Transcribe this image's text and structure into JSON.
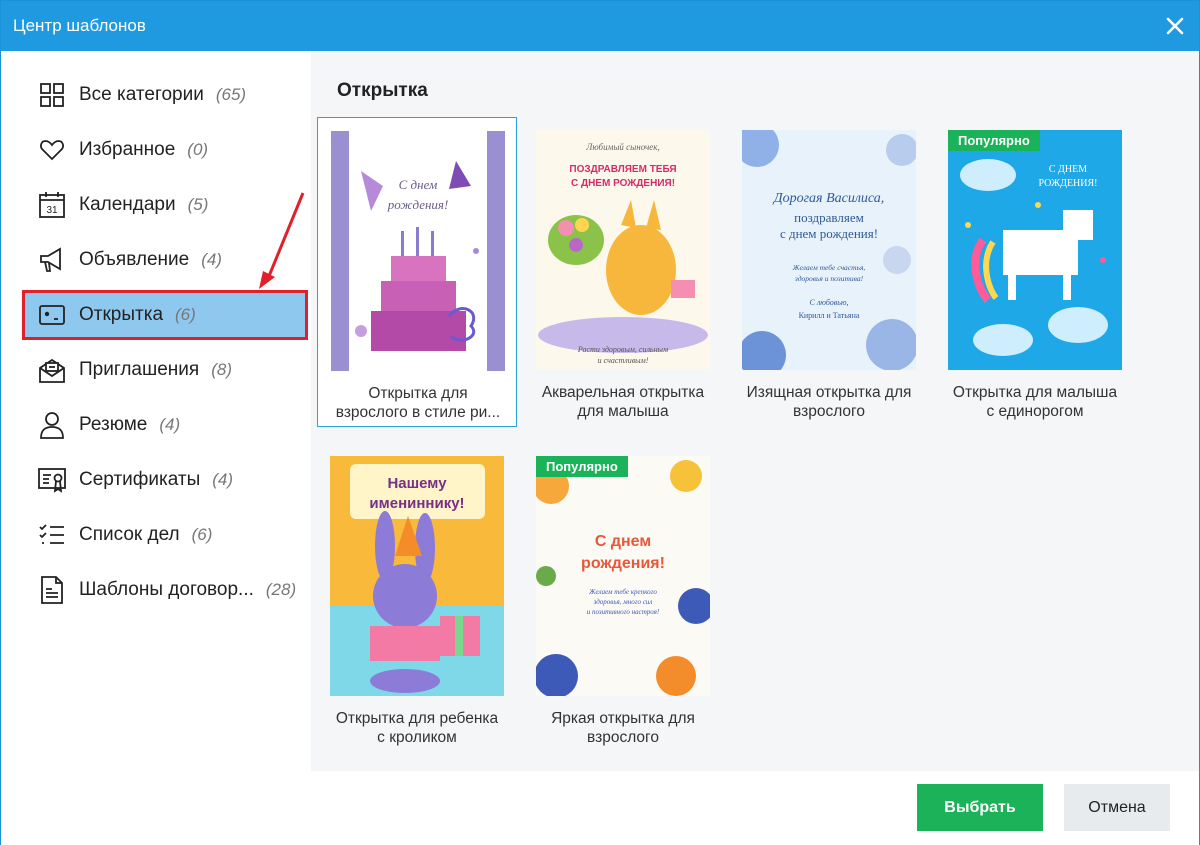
{
  "window": {
    "title": "Центр шаблонов"
  },
  "sidebar": {
    "items": [
      {
        "label": "Все категории",
        "count": "(65)",
        "icon": "grid-icon"
      },
      {
        "label": "Избранное",
        "count": "(0)",
        "icon": "heart-icon"
      },
      {
        "label": "Календари",
        "count": "(5)",
        "icon": "calendar-icon",
        "icon_text": "31"
      },
      {
        "label": "Объявление",
        "count": "(4)",
        "icon": "megaphone-icon"
      },
      {
        "label": "Открытка",
        "count": "(6)",
        "icon": "postcard-icon",
        "active": true
      },
      {
        "label": "Приглашения",
        "count": "(8)",
        "icon": "invitation-icon"
      },
      {
        "label": "Резюме",
        "count": "(4)",
        "icon": "person-icon"
      },
      {
        "label": "Сертификаты",
        "count": "(4)",
        "icon": "certificate-icon"
      },
      {
        "label": "Список дел",
        "count": "(6)",
        "icon": "checklist-icon"
      },
      {
        "label": "Шаблоны договор...",
        "count": "(28)",
        "icon": "document-icon"
      }
    ]
  },
  "main": {
    "section_title": "Открытка",
    "cards": [
      {
        "line1": "Открытка для",
        "line2": "взрослого в стиле ри...",
        "selected": true,
        "thumb": {
          "t1": "С днем",
          "t2": "рождения!"
        }
      },
      {
        "line1": "Акварельная открытка",
        "line2": "для малыша",
        "thumb": {
          "t1": "Любимый сыночек,",
          "t2": "ПОЗДРАВЛЯЕМ ТЕБЯ",
          "t3": "С ДНЕМ РОЖДЕНИЯ!",
          "t4": "Расти здоровым, сильным",
          "t5": "и счастливым!"
        }
      },
      {
        "line1": "Изящная открытка для",
        "line2": "взрослого",
        "thumb": {
          "t1": "Дорогая Василиса,",
          "t2": "поздравляем",
          "t3": "с днем рождения!",
          "t4": "Желаем тебе счастья,",
          "t5": "здоровья и позитива!",
          "t6": "С любовью,",
          "t7": "Кирилл и Татьяна"
        }
      },
      {
        "line1": "Открытка для малыша",
        "line2": "с единорогом",
        "badge": "Популярно",
        "thumb": {
          "t1": "С ДНЕМ",
          "t2": "РОЖДЕНИЯ!"
        }
      },
      {
        "line1": "Открытка для ребенка",
        "line2": "с кроликом",
        "thumb": {
          "t1": "Нашему",
          "t2": "имениннику!"
        }
      },
      {
        "line1": "Яркая открытка для",
        "line2": "взрослого",
        "badge": "Популярно",
        "thumb": {
          "t1": "С днем",
          "t2": "рождения!",
          "t3": "Желаем тебе крепкого",
          "t4": "здоровья, много сил",
          "t5": "и позитивного настроя!"
        }
      }
    ]
  },
  "footer": {
    "ok_label": "Выбрать",
    "cancel_label": "Отмена"
  }
}
